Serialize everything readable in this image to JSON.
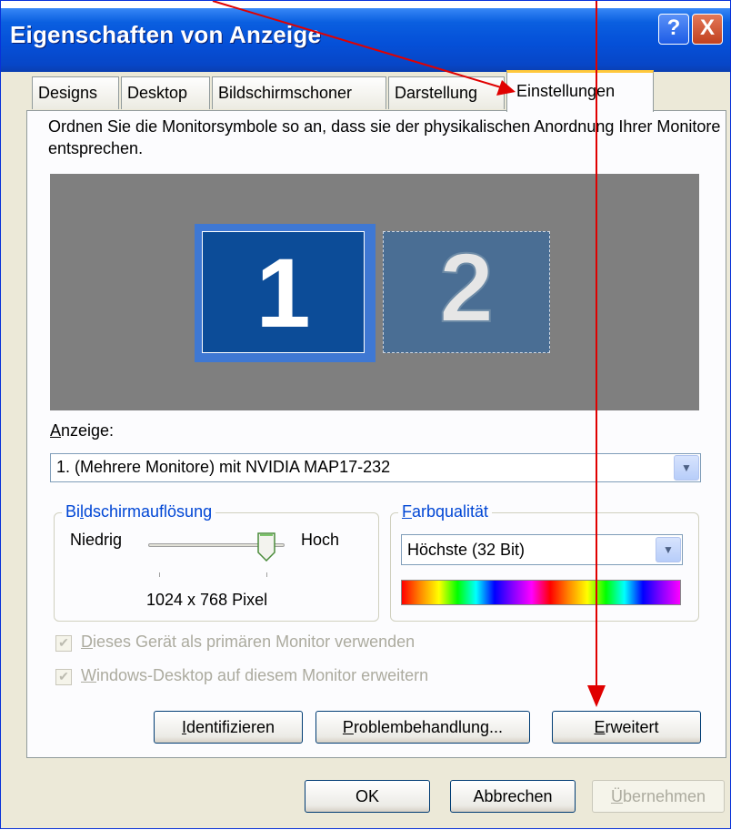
{
  "window": {
    "title": "Eigenschaften von Anzeige",
    "help_label": "?",
    "close_label": "X"
  },
  "tabs": [
    {
      "label": "Designs"
    },
    {
      "label": "Desktop"
    },
    {
      "label": "Bildschirmschoner"
    },
    {
      "label": "Darstellung"
    },
    {
      "label": "Einstellungen",
      "active": true
    }
  ],
  "settings": {
    "instruction": "Ordnen Sie die Monitorsymbole so an, dass sie der physikalischen Anordnung Ihrer Monitore entsprechen.",
    "monitors": [
      {
        "number": "1",
        "selected": true
      },
      {
        "number": "2",
        "selected": false
      }
    ],
    "display_label_accel": "A",
    "display_label_rest": "nzeige:",
    "display_value": "1. (Mehrere Monitore) mit NVIDIA MAP17-232",
    "resolution": {
      "group_title_pre": "Bi",
      "group_title_accel": "l",
      "group_title_post": "dschirmauflösung",
      "low_label": "Niedrig",
      "high_label": "Hoch",
      "value": "1024 x 768 Pixel"
    },
    "color": {
      "group_title_accel": "F",
      "group_title_rest": "arbqualität",
      "value": "Höchste (32 Bit)"
    },
    "primary_checkbox": {
      "accel": "D",
      "rest": "ieses Gerät als primären Monitor verwenden",
      "checked": true
    },
    "extend_checkbox": {
      "accel": "W",
      "rest": "indows-Desktop auf diesem Monitor erweitern",
      "checked": true
    },
    "buttons": {
      "identify_accel": "I",
      "identify_rest": "dentifizieren",
      "troubleshoot_accel": "P",
      "troubleshoot_rest": "roblembehandlung...",
      "advanced_accel": "E",
      "advanced_rest": "rweitert"
    }
  },
  "footer": {
    "ok_label": "OK",
    "cancel_label": "Abbrechen",
    "apply_accel": "Ü",
    "apply_rest": "bernehmen"
  },
  "colors": {
    "arrow": "#e00000",
    "title_bar": "#0a5fe0",
    "selected_monitor": "#0c4c98"
  }
}
